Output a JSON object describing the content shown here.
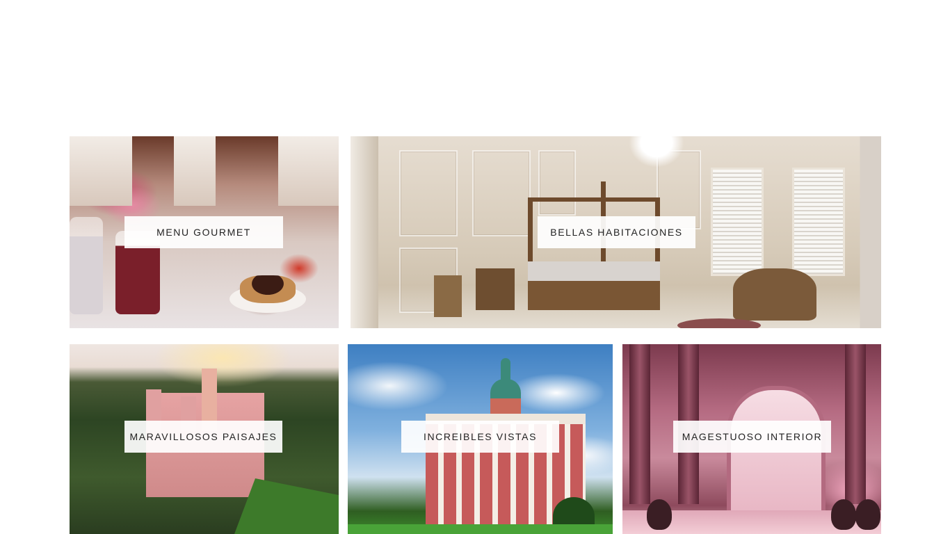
{
  "gallery": {
    "tiles": [
      {
        "label": "MENU GOURMET",
        "image": "gourmet-table-photo"
      },
      {
        "label": "BELLAS HABITACIONES",
        "image": "bedroom-photo"
      },
      {
        "label": "MARAVILLOSOS PAISAJES",
        "image": "castle-landscape-photo"
      },
      {
        "label": "INCREIBLES VISTAS",
        "image": "castle-view-photo"
      },
      {
        "label": "MAGESTUOSO INTERIOR",
        "image": "pink-interior-photo"
      }
    ]
  },
  "colors": {
    "page_background": "#ffffff",
    "label_background": "#ffffff",
    "label_text": "#222222"
  }
}
